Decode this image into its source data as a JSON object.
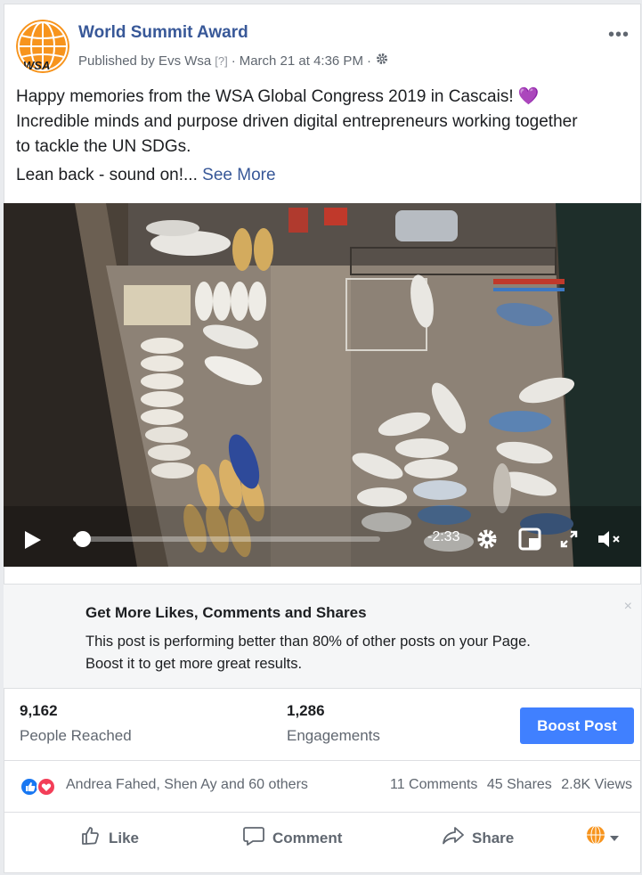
{
  "post": {
    "page_name": "World Summit Award",
    "avatar_text": "WSA",
    "published_by": "Published by Evs Wsa",
    "question_mark": "[?]",
    "separator": "·",
    "date": "March 21 at 4:36 PM",
    "text_line1": "Happy memories from the WSA Global Congress 2019 in Cascais! 💜",
    "text_line2": "Incredible minds and purpose driven digital entrepreneurs working together",
    "text_line3": "to tackle the UN SDGs.",
    "text_short": "Lean back - sound on!...",
    "see_more": "See More",
    "more_menu": "•••"
  },
  "video": {
    "time_remaining": "-2:33",
    "progress": 0.03,
    "icons": [
      "play-icon",
      "settings-icon",
      "pip-icon",
      "fullscreen-icon",
      "mute-icon"
    ]
  },
  "boost_panel": {
    "title": "Get More Likes, Comments and Shares",
    "body_line1": "This post is performing better than 80% of other posts on your Page.",
    "body_line2": "Boost it to get more great results.",
    "close": "×"
  },
  "stats": {
    "reached_value": "9,162",
    "reached_label": "People Reached",
    "engagements_value": "1,286",
    "engagements_label": "Engagements",
    "boost_button": "Boost Post"
  },
  "reactions": {
    "names": "Andrea Fahed, Shen Ay and 60 others",
    "comments": "11 Comments",
    "shares": "45 Shares",
    "views": "2.8K Views"
  },
  "actions": {
    "like": "Like",
    "comment": "Comment",
    "share": "Share"
  },
  "colors": {
    "link": "#385898",
    "boost": "#4080ff",
    "like_blue": "#1877f2",
    "love_red": "#f33e58",
    "avatar_orange": "#f7941d"
  }
}
